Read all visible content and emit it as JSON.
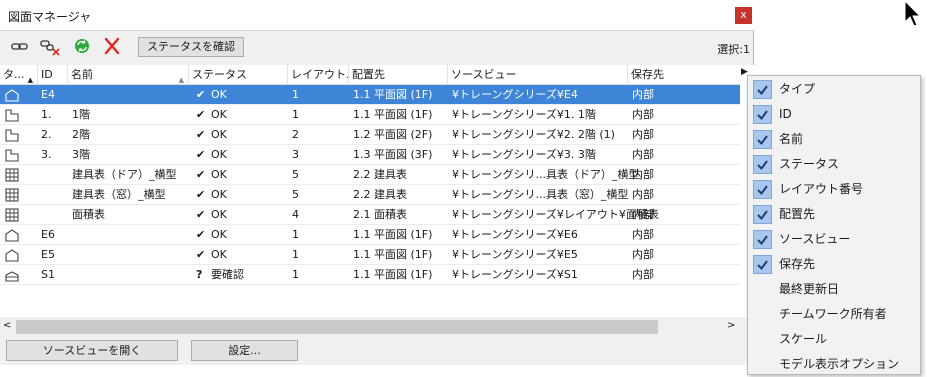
{
  "window": {
    "title": "図面マネージャ",
    "close_label": "x"
  },
  "toolbar": {
    "icons": [
      "link-icon",
      "unlink-icon",
      "refresh-icon",
      "delete-icon"
    ],
    "status_button": "ステータスを確認",
    "selection": "選択:1"
  },
  "grid": {
    "columns": [
      "タ...",
      "ID",
      "名前",
      "ステータス",
      "レイアウト...",
      "配置先",
      "ソースビュー",
      "保存先"
    ],
    "rows": [
      {
        "type": "layout",
        "id": "E4",
        "name": "",
        "status_icon": "✔",
        "status": "OK",
        "layout": "1",
        "placement": "1.1 平面図 (1F)",
        "source": "¥トレーングシリーズ¥E4",
        "storage": "内部",
        "selected": true
      },
      {
        "type": "plan",
        "id": "1.",
        "name": "1階",
        "status_icon": "✔",
        "status": "OK",
        "layout": "1",
        "placement": "1.1 平面図 (1F)",
        "source": "¥トレーングシリーズ¥1. 1階",
        "storage": "内部",
        "selected": false
      },
      {
        "type": "plan",
        "id": "2.",
        "name": "2階",
        "status_icon": "✔",
        "status": "OK",
        "layout": "2",
        "placement": "1.2 平面図 (2F)",
        "source": "¥トレーングシリーズ¥2. 2階 (1)",
        "storage": "内部",
        "selected": false
      },
      {
        "type": "plan",
        "id": "3.",
        "name": "3階",
        "status_icon": "✔",
        "status": "OK",
        "layout": "3",
        "placement": "1.3 平面図 (3F)",
        "source": "¥トレーングシリーズ¥3. 3階",
        "storage": "内部",
        "selected": false
      },
      {
        "type": "table",
        "id": "",
        "name": "建具表（ドア）_横型",
        "status_icon": "✔",
        "status": "OK",
        "layout": "5",
        "placement": "2.2 建具表",
        "source": "¥トレーングシリ...具表（ドア）_横型",
        "storage": "内部",
        "selected": false
      },
      {
        "type": "table",
        "id": "",
        "name": "建具表（窓）_横型",
        "status_icon": "✔",
        "status": "OK",
        "layout": "5",
        "placement": "2.2 建具表",
        "source": "¥トレーングシリ...具表（窓）_横型",
        "storage": "内部",
        "selected": false
      },
      {
        "type": "table",
        "id": "",
        "name": "面積表",
        "status_icon": "✔",
        "status": "OK",
        "layout": "4",
        "placement": "2.1 面積表",
        "source": "¥トレーングシリーズ¥レイアウト¥面積表",
        "storage": "内部",
        "selected": false
      },
      {
        "type": "elevation",
        "id": "E6",
        "name": "",
        "status_icon": "✔",
        "status": "OK",
        "layout": "1",
        "placement": "1.1 平面図 (1F)",
        "source": "¥トレーングシリーズ¥E6",
        "storage": "内部",
        "selected": false
      },
      {
        "type": "elevation",
        "id": "E5",
        "name": "",
        "status_icon": "✔",
        "status": "OK",
        "layout": "1",
        "placement": "1.1 平面図 (1F)",
        "source": "¥トレーングシリーズ¥E5",
        "storage": "内部",
        "selected": false
      },
      {
        "type": "section",
        "id": "S1",
        "name": "",
        "status_icon": "?",
        "status": "要確認",
        "layout": "1",
        "placement": "1.1 平面図 (1F)",
        "source": "¥トレーングシリーズ¥S1",
        "storage": "内部",
        "selected": false
      }
    ]
  },
  "footer": {
    "open_source_view": "ソースビューを開く",
    "settings": "設定..."
  },
  "column_menu": {
    "items": [
      {
        "label": "タイプ",
        "checked": true
      },
      {
        "label": "ID",
        "checked": true
      },
      {
        "label": "名前",
        "checked": true
      },
      {
        "label": "ステータス",
        "checked": true
      },
      {
        "label": "レイアウト番号",
        "checked": true
      },
      {
        "label": "配置先",
        "checked": true
      },
      {
        "label": "ソースビュー",
        "checked": true
      },
      {
        "label": "保存先",
        "checked": true
      },
      {
        "label": "最終更新日",
        "checked": false
      },
      {
        "label": "チームワーク所有者",
        "checked": false
      },
      {
        "label": "スケール",
        "checked": false
      },
      {
        "label": "モデル表示オプション",
        "checked": false
      }
    ]
  },
  "colors": {
    "selection": "#3e85d8",
    "close": "#c7332b",
    "refresh": "#2eaa3c",
    "delete": "#e0281f",
    "menu_check": "#a9c6ec"
  }
}
